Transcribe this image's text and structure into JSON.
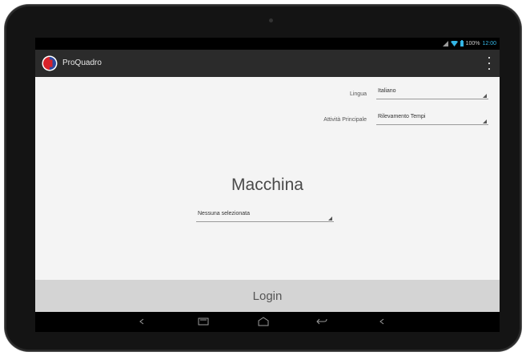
{
  "status_bar": {
    "battery_text": "100%",
    "time": "12:00"
  },
  "app_bar": {
    "title": "ProQuadro",
    "logo_icon": "app-logo-icon",
    "menu_icon": "overflow-menu-icon"
  },
  "form": {
    "language_label": "Lingua",
    "language_value": "Italiano",
    "main_function_label": "Attività Principale",
    "main_function_value": "Rilevamento Tempi"
  },
  "machine": {
    "title": "Macchina",
    "select_value": "Nessuna selezionata"
  },
  "login": {
    "label": "Login"
  },
  "nav_icons": [
    "back-icon",
    "recents-icon",
    "home-icon",
    "back-arrow-icon",
    "volume-icon"
  ],
  "colors": {
    "app_bar": "#2b2b2b",
    "content_bg": "#f4f4f4",
    "login_bg": "#d4d4d4",
    "logo_red": "#d8232a",
    "logo_blue": "#2e4aa0",
    "wifi_accent": "#33b5e5"
  }
}
